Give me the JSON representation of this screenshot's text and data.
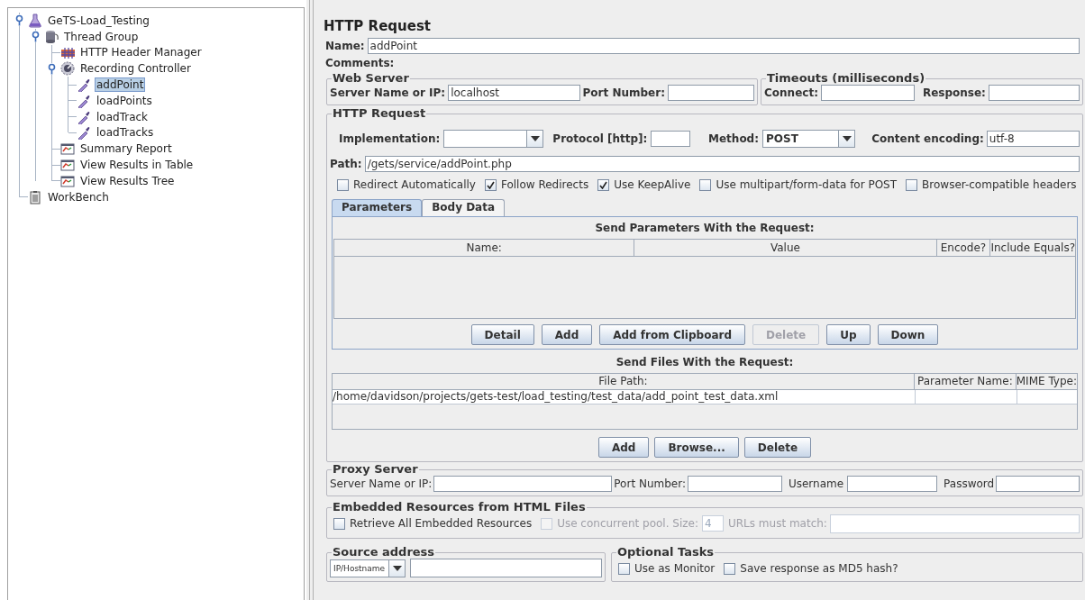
{
  "tree": [
    {
      "label": "GeTS-Load_Testing",
      "kind": "test-plan",
      "selected": false,
      "expanded": true,
      "children": [
        {
          "label": "Thread Group",
          "kind": "thread-group",
          "selected": false,
          "expanded": true,
          "children": [
            {
              "label": "HTTP Header Manager",
              "kind": "config",
              "selected": false
            },
            {
              "label": "Recording Controller",
              "kind": "controller",
              "selected": false,
              "expanded": true,
              "children": [
                {
                  "label": "addPoint",
                  "kind": "sampler",
                  "selected": true
                },
                {
                  "label": "loadPoints",
                  "kind": "sampler",
                  "selected": false
                },
                {
                  "label": "loadTrack",
                  "kind": "sampler",
                  "selected": false
                },
                {
                  "label": "loadTracks",
                  "kind": "sampler",
                  "selected": false
                }
              ]
            },
            {
              "label": "Summary Report",
              "kind": "listener",
              "selected": false
            },
            {
              "label": "View Results in Table",
              "kind": "listener",
              "selected": false
            },
            {
              "label": "View Results Tree",
              "kind": "listener",
              "selected": false
            }
          ]
        }
      ]
    },
    {
      "label": "WorkBench",
      "kind": "workbench",
      "selected": false
    }
  ],
  "editor": {
    "title": "HTTP Request",
    "name": {
      "label": "Name:",
      "value": "addPoint"
    },
    "comments": {
      "label": "Comments:"
    },
    "web_server": {
      "title": "Web Server",
      "fields": [
        {
          "label": "Server Name or IP:",
          "value": "localhost"
        },
        {
          "label": "Port Number:"
        }
      ]
    },
    "timeouts": {
      "title": "Timeouts (milliseconds)",
      "fields": [
        {
          "label": "Connect:"
        },
        {
          "label": "Response:"
        }
      ]
    },
    "http_request": {
      "title": "HTTP Request",
      "implementation": {
        "label": "Implementation:"
      },
      "protocol": {
        "label": "Protocol [http]:"
      },
      "method": {
        "label": "Method:",
        "value": "POST"
      },
      "content_encoding": {
        "label": "Content encoding:",
        "value": "utf-8"
      },
      "path": {
        "label": "Path:",
        "value": "/gets/service/addPoint.php"
      },
      "options": [
        {
          "label": "Redirect Automatically",
          "checked": false
        },
        {
          "label": "Follow Redirects",
          "checked": true
        },
        {
          "label": "Use KeepAlive",
          "checked": true
        },
        {
          "label": "Use multipart/form-data for POST",
          "checked": false
        },
        {
          "label": "Browser-compatible headers",
          "checked": false
        }
      ],
      "tabs": [
        {
          "label": "Parameters",
          "selected": true
        },
        {
          "label": "Body Data",
          "selected": false
        }
      ],
      "parameters": {
        "title": "Send Parameters With the Request:",
        "columns": [
          "Name:",
          "Value",
          "Encode?",
          "Include Equals?"
        ],
        "buttons": [
          {
            "label": "Detail",
            "disabled": false
          },
          {
            "label": "Add",
            "disabled": false
          },
          {
            "label": "Add from Clipboard",
            "disabled": false
          },
          {
            "label": "Delete",
            "disabled": true
          },
          {
            "label": "Up",
            "disabled": false
          },
          {
            "label": "Down",
            "disabled": false
          }
        ]
      },
      "files": {
        "title": "Send Files With the Request:",
        "columns": [
          "File Path:",
          "Parameter Name:",
          "MIME Type:"
        ],
        "rows": [
          [
            "/home/davidson/projects/gets-test/load_testing/test_data/add_point_test_data.xml"
          ]
        ],
        "buttons": [
          {
            "label": "Add",
            "disabled": false
          },
          {
            "label": "Browse...",
            "disabled": false
          },
          {
            "label": "Delete",
            "disabled": false
          }
        ]
      }
    },
    "proxy": {
      "title": "Proxy Server",
      "fields": [
        {
          "label": "Server Name or IP:"
        },
        {
          "label": "Port Number:"
        },
        {
          "label": "Username"
        },
        {
          "label": "Password"
        }
      ]
    },
    "embedded": {
      "title": "Embedded Resources from HTML Files",
      "retrieve": {
        "label": "Retrieve All Embedded Resources",
        "checked": false,
        "disabled": false
      },
      "concurrent": {
        "label": "Use concurrent pool. Size:",
        "checked": false,
        "disabled": true
      },
      "pool_size": {
        "value": "4",
        "disabled": true
      },
      "url_match": {
        "label": "URLs must match:",
        "disabled": true
      }
    },
    "source_address": {
      "title": "Source address",
      "type": "IP/Hostname"
    },
    "optional_tasks": {
      "title": "Optional Tasks",
      "options": [
        {
          "label": "Use as Monitor",
          "checked": false
        },
        {
          "label": "Save response as MD5 hash?",
          "checked": false
        }
      ]
    }
  }
}
